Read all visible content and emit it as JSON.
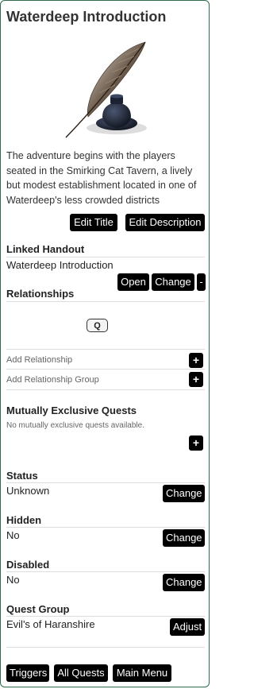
{
  "header": {
    "title": "Waterdeep Introduction"
  },
  "image": {
    "icon": "quill-and-inkwell-icon"
  },
  "description": "The adventure begins with the players seated in the Smirking Cat Tavern, a lively but modest establishment located in one of Waterdeep's less crowded districts",
  "actions": {
    "edit_title": "Edit Title",
    "edit_description": "Edit Description"
  },
  "linked_handout": {
    "heading": "Linked Handout",
    "value": "Waterdeep Introduction",
    "open_label": "Open",
    "change_label": "Change",
    "remove_label": "-"
  },
  "relationships": {
    "heading": "Relationships",
    "search_label": "Q",
    "add_relationship": "Add Relationship",
    "add_relationship_group": "Add Relationship Group",
    "plus_label": "+"
  },
  "mutually_exclusive": {
    "heading": "Mutually Exclusive Quests",
    "empty_text": "No mutually exclusive quests available.",
    "plus_label": "+"
  },
  "status": {
    "heading": "Status",
    "value": "Unknown",
    "button": "Change"
  },
  "hidden": {
    "heading": "Hidden",
    "value": "No",
    "button": "Change"
  },
  "disabled": {
    "heading": "Disabled",
    "value": "No",
    "button": "Change"
  },
  "quest_group": {
    "heading": "Quest Group",
    "value": "Evil's of Haranshire",
    "button": "Adjust"
  },
  "footer": {
    "triggers": "Triggers",
    "all_quests": "All Quests",
    "main_menu": "Main Menu"
  },
  "colors": {
    "button_bg": "#000000",
    "border": "#2d6b4a"
  }
}
